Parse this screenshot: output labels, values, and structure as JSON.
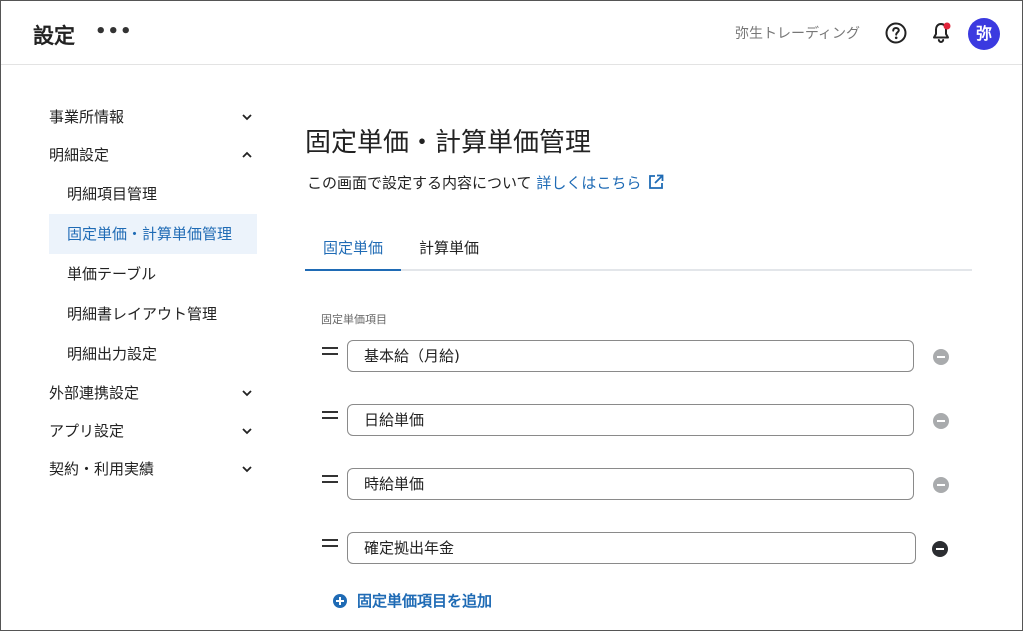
{
  "header": {
    "title": "設定",
    "more": "•••",
    "company": "弥生トレーディング",
    "avatar_text": "弥"
  },
  "sidebar": {
    "items": [
      {
        "label": "事業所情報",
        "expanded": false
      },
      {
        "label": "明細設定",
        "expanded": true
      },
      {
        "label": "外部連携設定",
        "expanded": false
      },
      {
        "label": "アプリ設定",
        "expanded": false
      },
      {
        "label": "契約・利用実績",
        "expanded": false
      }
    ],
    "sub_items": [
      {
        "label": "明細項目管理",
        "active": false
      },
      {
        "label": "固定単価・計算単価管理",
        "active": true
      },
      {
        "label": "単価テーブル",
        "active": false
      },
      {
        "label": "明細書レイアウト管理",
        "active": false
      },
      {
        "label": "明細出力設定",
        "active": false
      }
    ]
  },
  "main": {
    "title": "固定単価・計算単価管理",
    "description": "この画面で設定する内容について",
    "link_text": "詳しくはこちら",
    "tabs": [
      {
        "label": "固定単価",
        "active": true
      },
      {
        "label": "計算単価",
        "active": false
      }
    ],
    "field_label": "固定単価項目",
    "items": [
      {
        "value": "基本給（月給)",
        "remove_enabled": false
      },
      {
        "value": "日給単価",
        "remove_enabled": false
      },
      {
        "value": "時給単価",
        "remove_enabled": false
      },
      {
        "value": "確定拠出年金",
        "remove_enabled": true
      }
    ],
    "add_label": "固定単価項目を追加"
  },
  "colors": {
    "accent": "#1f6bb5",
    "avatar": "#3b3ae0",
    "notification_dot": "#e0243a",
    "active_bg": "#ecf3fb"
  }
}
